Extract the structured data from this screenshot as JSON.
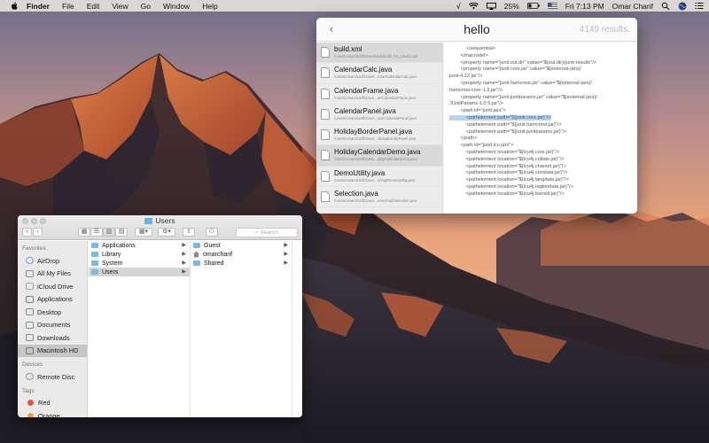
{
  "menubar": {
    "app_name": "Finder",
    "menus": [
      "File",
      "Edit",
      "View",
      "Go",
      "Window",
      "Help"
    ],
    "battery": "25%",
    "clock": "Fri 7:13 PM",
    "user": "Omar Charif"
  },
  "search_window": {
    "query": "hello",
    "result_count": "4149 results.",
    "results": [
      {
        "name": "build.xml",
        "path": "/Users/omarcharif/Downloads/build_03_13sold.xml"
      },
      {
        "name": "CalendarCalc.java",
        "path": "/Users/omarcharif/Down…ndar/CalendarCalc.java"
      },
      {
        "name": "CalendarFrame.java",
        "path": "/Users/omarcharif/Down…ar/CalendarFrame.java"
      },
      {
        "name": "CalendarPanel.java",
        "path": "/Users/omarcharif/Down…dar/CalendarPanel.java"
      },
      {
        "name": "HolidayBorderPanel.java",
        "path": "/Users/omarcharif/Down…olidayBorderPanel.java"
      },
      {
        "name": "HolidayCalendarDemo.java",
        "path": "/Users/omarcharif/Down…idayCalendarDemo.java"
      },
      {
        "name": "DemoUtility.java",
        "path": "/Users/omarcharif/Down…o/impl/DemoUtility.java"
      },
      {
        "name": "Selection.java",
        "path": "/Users/omarcharif/Down…emo/impl/Selection.java"
      }
    ],
    "preview_lines": [
      "            </sequential>",
      "        </macrodef>",
      "",
      "        <property name=\"junit.out.dir\" value=\"${out.dir}/junit-results\"/>",
      "        <property name=\"junit.core.jar\" value=\"${external-jars}/",
      "junit-4.12.jar\"/>",
      "        <property name=\"junit.hamcrest.jar\" value=\"${external-jars}/",
      "hamcrest-core-1.3.jar\"/>",
      "        <property name=\"junit.junitparams.jar\" value=\"${external-jars}/",
      "JUnitParams-1.0.5.jar\"/>",
      "        <path id=\"junit.jars\">",
      "            <pathelement path=\"${junit.core.jar}\"/>",
      "            <pathelement path=\"${junit.hamcrest.jar}\"/>",
      "            <pathelement path=\"${junit.junitparams.jar}\"/>",
      "        </path>",
      "",
      "        <path id=\"junit.icu.jars\">",
      "            <pathelement location=\"${icu4j.core.jar}\"/>",
      "            <pathelement location=\"${icu4j.collate.jar}\"/>",
      "            <pathelement location=\"${icu4j.charset.jar}\"/>",
      "            <pathelement location=\"${icu4j.currdata.jar}\"/>",
      "            <pathelement location=\"${icu4j.langdata.jar}\"/>",
      "            <pathelement location=\"${icu4j.regiondata.jar}\"/>",
      "            <pathelement location=\"${icu4j.translit.jar}\"/>"
    ],
    "highlight_line": 11
  },
  "finder": {
    "title": "Users",
    "search_placeholder": "Search",
    "sidebar": {
      "favorites_label": "Favorites",
      "favorites": [
        {
          "label": "AirDrop",
          "icon": "airdrop-icon"
        },
        {
          "label": "All My Files",
          "icon": "all-files-icon"
        },
        {
          "label": "iCloud Drive",
          "icon": "cloud-icon"
        },
        {
          "label": "Applications",
          "icon": "applications-icon"
        },
        {
          "label": "Desktop",
          "icon": "desktop-icon"
        },
        {
          "label": "Documents",
          "icon": "documents-icon"
        },
        {
          "label": "Downloads",
          "icon": "downloads-icon"
        },
        {
          "label": "Macintosh HD",
          "icon": "hard-drive-icon"
        }
      ],
      "devices_label": "Devices",
      "devices": [
        {
          "label": "Remote Disc",
          "icon": "disc-icon"
        }
      ],
      "tags_label": "Tags",
      "tags": [
        {
          "label": "Red",
          "color": "#f0504a"
        },
        {
          "label": "Orange",
          "color": "#f5a034"
        }
      ]
    },
    "column1": [
      {
        "label": "Applications"
      },
      {
        "label": "Library"
      },
      {
        "label": "System"
      },
      {
        "label": "Users"
      }
    ],
    "column2": [
      {
        "label": "Guest"
      },
      {
        "label": "omarcharif"
      },
      {
        "label": "Shared"
      }
    ]
  }
}
